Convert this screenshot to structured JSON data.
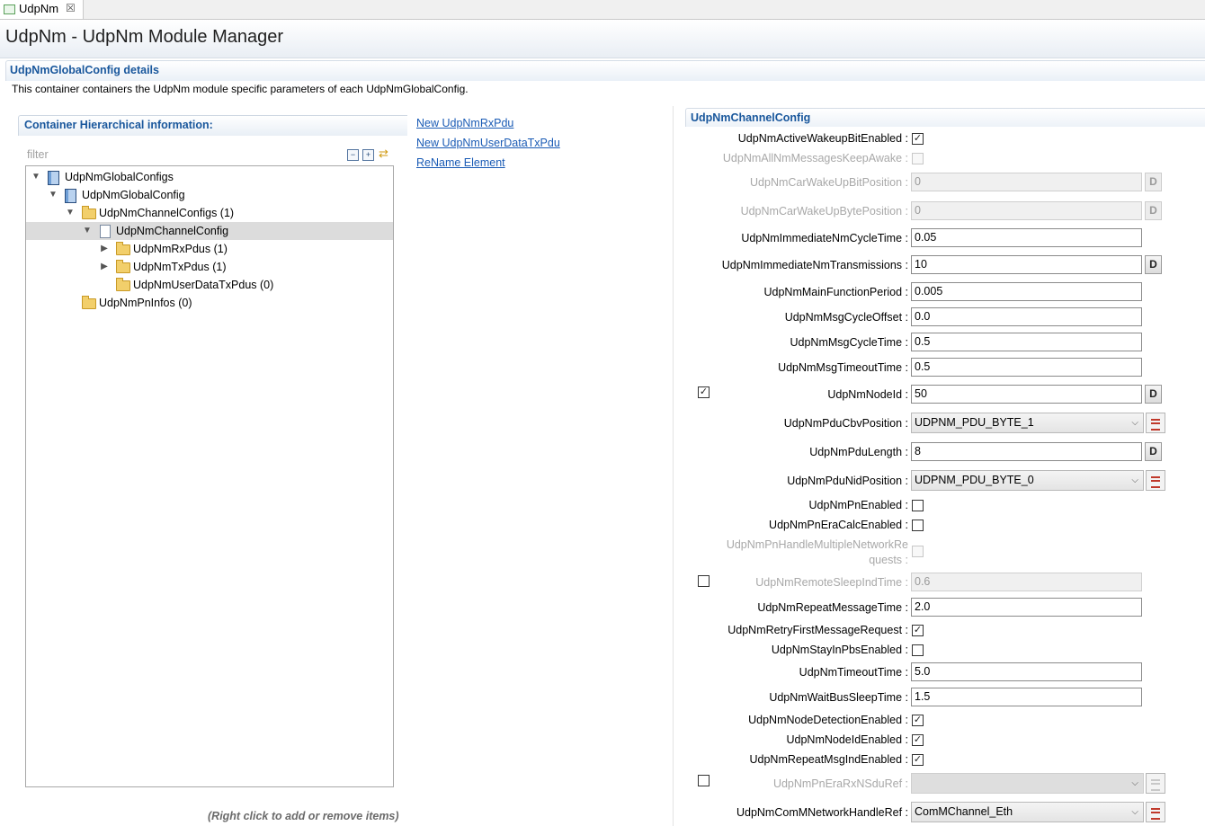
{
  "tab": {
    "label": "UdpNm",
    "close_glyph": "☒"
  },
  "page_title": "UdpNm - UdpNm Module Manager",
  "section": {
    "title": "UdpNmGlobalConfig details",
    "description": "This container containers the UdpNm module specific parameters of each UdpNmGlobalConfig."
  },
  "hierarchy": {
    "title": "Container Hierarchical information:",
    "filter_placeholder": "filter",
    "toolbar_icons": [
      "collapse-all-icon",
      "expand-all-icon",
      "link-with-editor-icon"
    ],
    "toolbar_glyphs": [
      "−",
      "+",
      "⇄"
    ],
    "tree": [
      {
        "label": "UdpNmGlobalConfigs",
        "expanded": true,
        "icon": "module-icon"
      },
      {
        "label": "UdpNmGlobalConfig",
        "expanded": true,
        "icon": "module-icon"
      },
      {
        "label": "UdpNmChannelConfigs (1)",
        "expanded": true,
        "icon": "folder-icon"
      },
      {
        "label": "UdpNmChannelConfig",
        "expanded": true,
        "icon": "document-icon",
        "selected": true
      },
      {
        "label": "UdpNmRxPdus (1)",
        "expanded": false,
        "icon": "folder-icon"
      },
      {
        "label": "UdpNmTxPdus (1)",
        "expanded": false,
        "icon": "folder-icon"
      },
      {
        "label": "UdpNmUserDataTxPdus (0)",
        "icon": "folder-icon"
      },
      {
        "label": "UdpNmPnInfos (0)",
        "icon": "folder-icon"
      }
    ],
    "footer_hint": "(Right click to add or remove items)"
  },
  "actions": {
    "new_rx_pdu": "New UdpNmRxPdu",
    "new_user_data_tx_pdu": "New UdpNmUserDataTxPdu",
    "rename": "ReName Element"
  },
  "channel": {
    "title": "UdpNmChannelConfig",
    "glyphs": {
      "check": "✓",
      "caret": "⌵",
      "d": "D"
    },
    "params": {
      "active_wakeup": {
        "label": "UdpNmActiveWakeupBitEnabled :",
        "checked": true
      },
      "all_nm_keep_awake": {
        "label": "UdpNmAllNmMessagesKeepAwake :",
        "checked": false,
        "disabled": true
      },
      "car_wakeup_bit_pos": {
        "label": "UdpNmCarWakeUpBitPosition :",
        "value": "0",
        "disabled": true
      },
      "car_wakeup_byte_pos": {
        "label": "UdpNmCarWakeUpBytePosition :",
        "value": "0",
        "disabled": true
      },
      "immediate_cycle": {
        "label": "UdpNmImmediateNmCycleTime :",
        "value": "0.05"
      },
      "immediate_tx": {
        "label": "UdpNmImmediateNmTransmissions :",
        "value": "10"
      },
      "main_function_period": {
        "label": "UdpNmMainFunctionPeriod :",
        "value": "0.005"
      },
      "msg_cycle_offset": {
        "label": "UdpNmMsgCycleOffset :",
        "value": "0.0"
      },
      "msg_cycle_time": {
        "label": "UdpNmMsgCycleTime :",
        "value": "0.5"
      },
      "msg_timeout_time": {
        "label": "UdpNmMsgTimeoutTime :",
        "value": "0.5"
      },
      "node_id": {
        "label": "UdpNmNodeId :",
        "value": "50",
        "enable_checked": true
      },
      "pdu_cbv_position": {
        "label": "UdpNmPduCbvPosition :",
        "value": "UDPNM_PDU_BYTE_1"
      },
      "pdu_length": {
        "label": "UdpNmPduLength :",
        "value": "8"
      },
      "pdu_nid_position": {
        "label": "UdpNmPduNidPosition :",
        "value": "UDPNM_PDU_BYTE_0"
      },
      "pn_enabled": {
        "label": "UdpNmPnEnabled :",
        "checked": false
      },
      "pn_era_calc": {
        "label": "UdpNmPnEraCalcEnabled :",
        "checked": false
      },
      "pn_handle_multi": {
        "label_line1": "UdpNmPnHandleMultipleNetworkRe",
        "label_line2": "quests :",
        "checked": false,
        "disabled": true
      },
      "remote_sleep_ind": {
        "label": "UdpNmRemoteSleepIndTime :",
        "value": "0.6",
        "disabled": true,
        "enable_checked": false
      },
      "repeat_message_time": {
        "label": "UdpNmRepeatMessageTime :",
        "value": "2.0"
      },
      "retry_first_msg": {
        "label": "UdpNmRetryFirstMessageRequest :",
        "checked": true
      },
      "stay_in_pbs": {
        "label": "UdpNmStayInPbsEnabled :",
        "checked": false
      },
      "timeout_time": {
        "label": "UdpNmTimeoutTime :",
        "value": "5.0"
      },
      "wait_bus_sleep": {
        "label": "UdpNmWaitBusSleepTime :",
        "value": "1.5"
      },
      "node_detection": {
        "label": "UdpNmNodeDetectionEnabled :",
        "checked": true
      },
      "node_id_enabled": {
        "label": "UdpNmNodeIdEnabled :",
        "checked": true
      },
      "repeat_msg_ind": {
        "label": "UdpNmRepeatMsgIndEnabled :",
        "checked": true
      },
      "pn_era_rx_ref": {
        "label": "UdpNmPnEraRxNSduRef :",
        "value": "",
        "disabled": true,
        "enable_checked": false
      },
      "comm_network_handle": {
        "label": "UdpNmComMNetworkHandleRef :",
        "value": "ComMChannel_Eth"
      }
    }
  }
}
